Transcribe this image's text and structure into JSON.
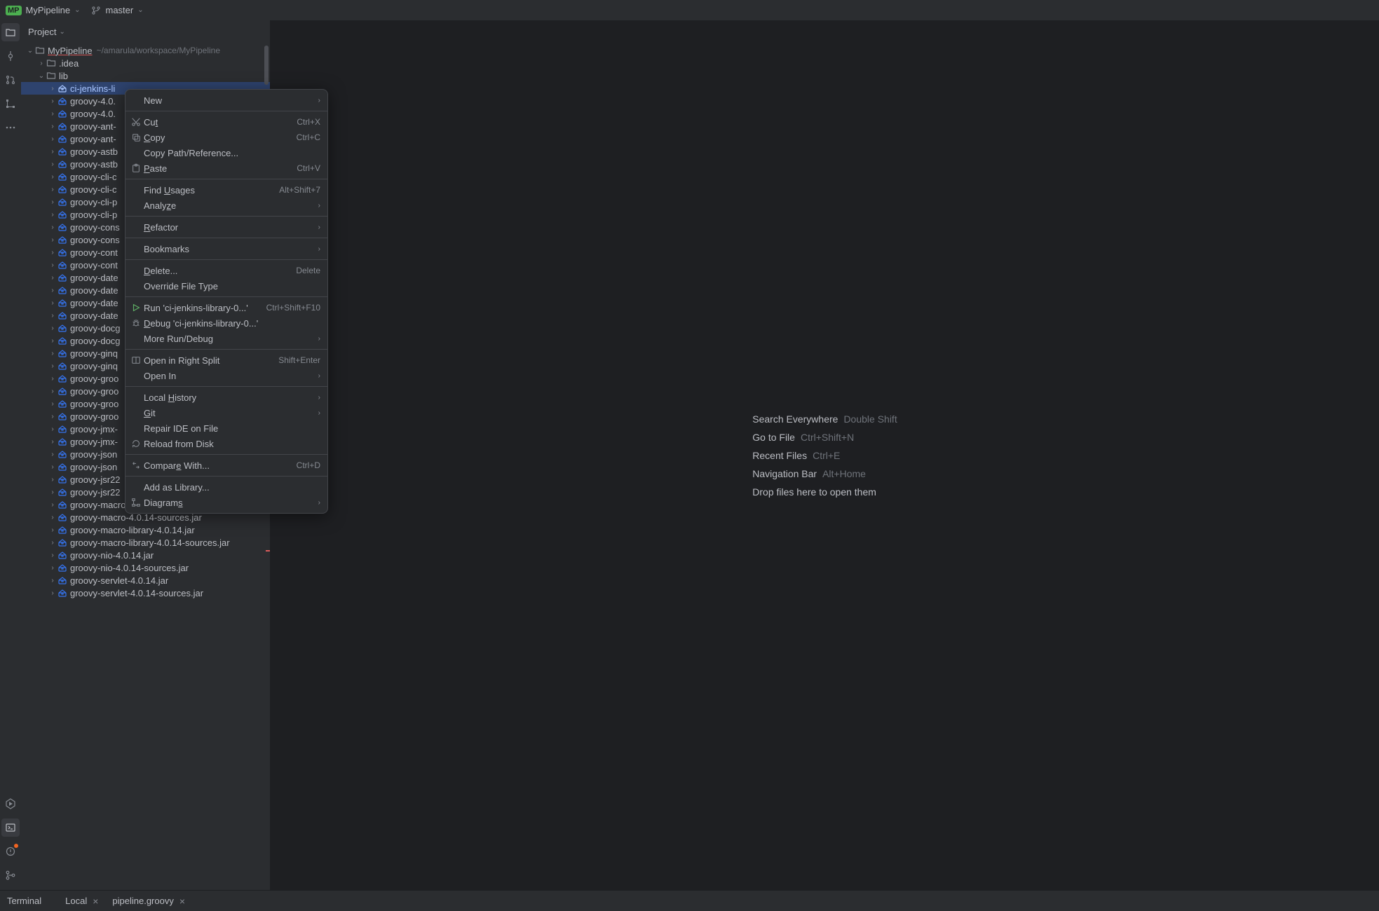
{
  "topbar": {
    "project_badge": "MP",
    "project_name": "MyPipeline",
    "branch_name": "master"
  },
  "sidebar": {
    "project_label": "Project"
  },
  "tree": {
    "root": {
      "name": "MyPipeline",
      "path": "~/amarula/workspace/MyPipeline"
    },
    "idea": ".idea",
    "lib": "lib",
    "selected": "ci-jenkins-li",
    "files": [
      "groovy-4.0.",
      "groovy-4.0.",
      "groovy-ant-",
      "groovy-ant-",
      "groovy-astb",
      "groovy-astb",
      "groovy-cli-c",
      "groovy-cli-c",
      "groovy-cli-p",
      "groovy-cli-p",
      "groovy-cons",
      "groovy-cons",
      "groovy-cont",
      "groovy-cont",
      "groovy-date",
      "groovy-date",
      "groovy-date",
      "groovy-date",
      "groovy-docg",
      "groovy-docg",
      "groovy-ginq",
      "groovy-ginq",
      "groovy-groo",
      "groovy-groo",
      "groovy-groo",
      "groovy-groo",
      "groovy-jmx-",
      "groovy-jmx-",
      "groovy-json",
      "groovy-json",
      "groovy-jsr22",
      "groovy-jsr22",
      "groovy-macro-4.0.14.jar",
      "groovy-macro-4.0.14-sources.jar",
      "groovy-macro-library-4.0.14.jar",
      "groovy-macro-library-4.0.14-sources.jar",
      "groovy-nio-4.0.14.jar",
      "groovy-nio-4.0.14-sources.jar",
      "groovy-servlet-4.0.14.jar",
      "groovy-servlet-4.0.14-sources.jar"
    ]
  },
  "context_menu": {
    "items": [
      {
        "label": "New",
        "submenu": true
      },
      {
        "sep": true
      },
      {
        "icon": "cut",
        "label_html": "Cu<span class='u'>t</span>",
        "label": "Cut",
        "shortcut": "Ctrl+X"
      },
      {
        "icon": "copy",
        "label_html": "<span class='u'>C</span>opy",
        "label": "Copy",
        "shortcut": "Ctrl+C"
      },
      {
        "label": "Copy Path/Reference..."
      },
      {
        "icon": "paste",
        "label_html": "<span class='u'>P</span>aste",
        "label": "Paste",
        "shortcut": "Ctrl+V"
      },
      {
        "sep": true
      },
      {
        "label_html": "Find <span class='u'>U</span>sages",
        "label": "Find Usages",
        "shortcut": "Alt+Shift+7"
      },
      {
        "label_html": "Analy<span class='u'>z</span>e",
        "label": "Analyze",
        "submenu": true
      },
      {
        "sep": true
      },
      {
        "label_html": "<span class='u'>R</span>efactor",
        "label": "Refactor",
        "submenu": true
      },
      {
        "sep": true
      },
      {
        "label": "Bookmarks",
        "submenu": true
      },
      {
        "sep": true
      },
      {
        "label_html": "<span class='u'>D</span>elete...",
        "label": "Delete...",
        "shortcut": "Delete"
      },
      {
        "label": "Override File Type"
      },
      {
        "sep": true
      },
      {
        "icon": "run",
        "label": "Run 'ci-jenkins-library-0...'",
        "shortcut": "Ctrl+Shift+F10"
      },
      {
        "icon": "debug",
        "label_html": "<span class='u'>D</span>ebug 'ci-jenkins-library-0...'",
        "label": "Debug 'ci-jenkins-library-0...'"
      },
      {
        "label": "More Run/Debug",
        "submenu": true
      },
      {
        "sep": true
      },
      {
        "icon": "split",
        "label": "Open in Right Split",
        "shortcut": "Shift+Enter"
      },
      {
        "label": "Open In",
        "submenu": true
      },
      {
        "sep": true
      },
      {
        "label_html": "Local <span class='u'>H</span>istory",
        "label": "Local History",
        "submenu": true
      },
      {
        "label_html": "<span class='u'>G</span>it",
        "label": "Git",
        "submenu": true
      },
      {
        "label": "Repair IDE on File"
      },
      {
        "icon": "reload",
        "label": "Reload from Disk"
      },
      {
        "sep": true
      },
      {
        "icon": "compare",
        "label_html": "Compar<span class='u'>e</span> With...",
        "label": "Compare With...",
        "shortcut": "Ctrl+D"
      },
      {
        "sep": true
      },
      {
        "label": "Add as Library..."
      },
      {
        "icon": "diagram",
        "label_html": "Diagram<span class='u'>s</span>",
        "label": "Diagrams",
        "submenu": true
      }
    ]
  },
  "editor": {
    "hints": [
      {
        "label": "Search Everywhere",
        "shortcut": "Double Shift"
      },
      {
        "label": "Go to File",
        "shortcut": "Ctrl+Shift+N"
      },
      {
        "label": "Recent Files",
        "shortcut": "Ctrl+E"
      },
      {
        "label": "Navigation Bar",
        "shortcut": "Alt+Home"
      },
      {
        "label": "Drop files here to open them",
        "shortcut": ""
      }
    ]
  },
  "bottom": {
    "terminal": "Terminal",
    "tabs": [
      "Local",
      "pipeline.groovy"
    ]
  }
}
